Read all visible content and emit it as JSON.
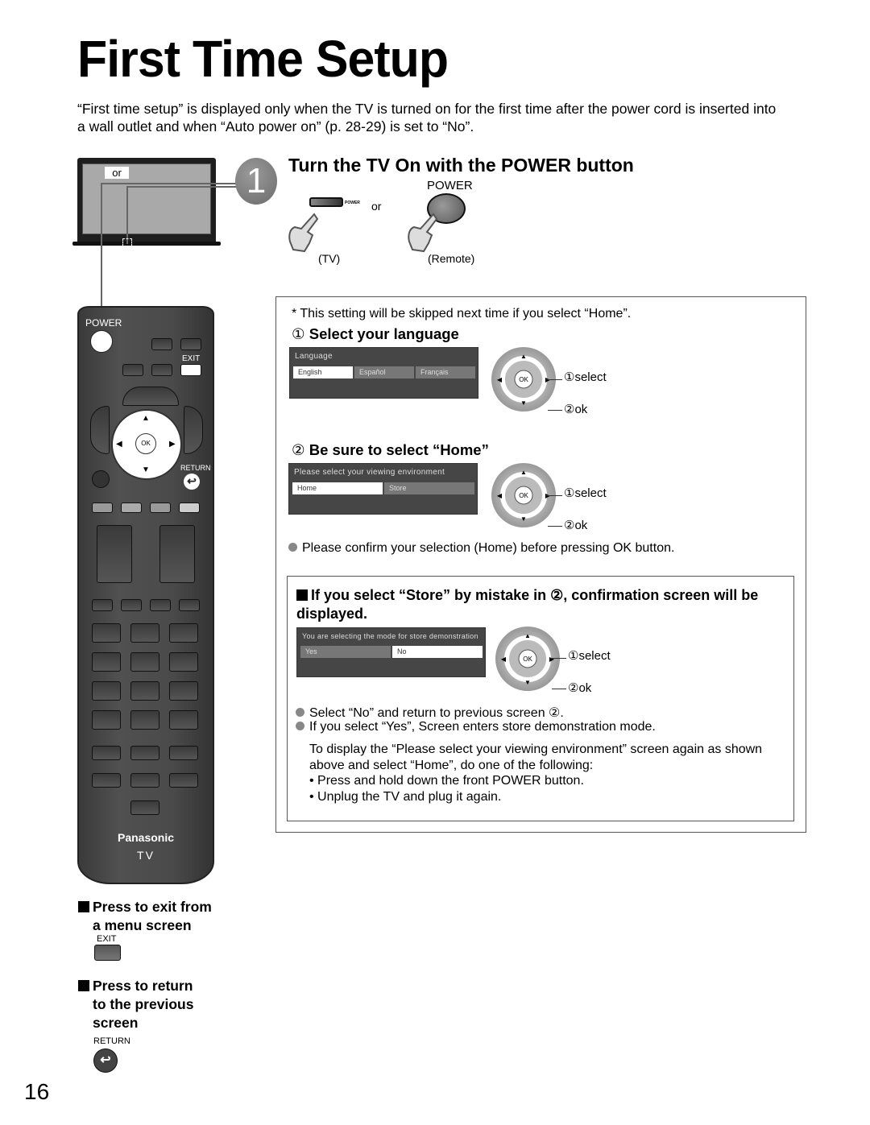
{
  "page": {
    "title": "First Time Setup",
    "intro": "“First time setup” is displayed only when the TV is turned on for the first time after the power cord is inserted into a wall outlet and when “Auto power on” (p. 28-29) is set to “No”.",
    "page_number": "16"
  },
  "tv_illustration": {
    "or_label": "or"
  },
  "step1": {
    "number": "1",
    "heading": "Turn the TV On with the POWER button",
    "power_label": "POWER",
    "tv_power_label": "POWER",
    "or_label": "or",
    "tv_caption": "(TV)",
    "remote_caption": "(Remote)"
  },
  "remote": {
    "power_label": "POWER",
    "exit_label": "EXIT",
    "ok_label": "OK",
    "return_label": "RETURN",
    "return_icon": "return-arrow-icon",
    "brand": "Panasonic",
    "model": "TV"
  },
  "setup_box": {
    "note": "* This setting will be skipped next time if you select “Home”.",
    "language": {
      "marker": "①",
      "heading": "Select your language",
      "osd_title": "Language",
      "options": [
        "English",
        "Español",
        "Français"
      ],
      "selected": "English"
    },
    "environment": {
      "marker": "②",
      "heading": "Be sure to select “Home”",
      "osd_title": "Please select your viewing environment",
      "options": [
        "Home",
        "Store"
      ],
      "selected": "Home"
    },
    "controls": {
      "select_marker": "①",
      "select_label": "select",
      "ok_marker": "②",
      "ok_label": "ok",
      "ok_button": "OK"
    },
    "confirm_note": "Please confirm your selection (Home) before pressing OK button.",
    "store_mistake": {
      "heading": "If you select “Store” by mistake in ②, confirmation screen will be displayed.",
      "osd_title": "You are selecting the mode for store demonstration",
      "options": [
        "Yes",
        "No"
      ],
      "selected": "No",
      "bullets": [
        "Select “No” and return to previous screen ②.",
        "If you select “Yes”, Screen enters store demonstration mode."
      ],
      "redisplay_intro": "To display the “Please select your viewing environment” screen again as shown above and select “Home”, do one of the following:",
      "redisplay_steps": [
        "• Press and hold down the front POWER button.",
        "• Unplug the TV and plug it again."
      ]
    }
  },
  "side_notes": {
    "exit": {
      "text_line1": "Press to exit from",
      "text_line2": "a menu screen",
      "key_label": "EXIT"
    },
    "return": {
      "text_line1": "Press to return",
      "text_line2": "to the previous",
      "text_line3": "screen",
      "key_label": "RETURN",
      "key_icon": "⮌"
    }
  }
}
